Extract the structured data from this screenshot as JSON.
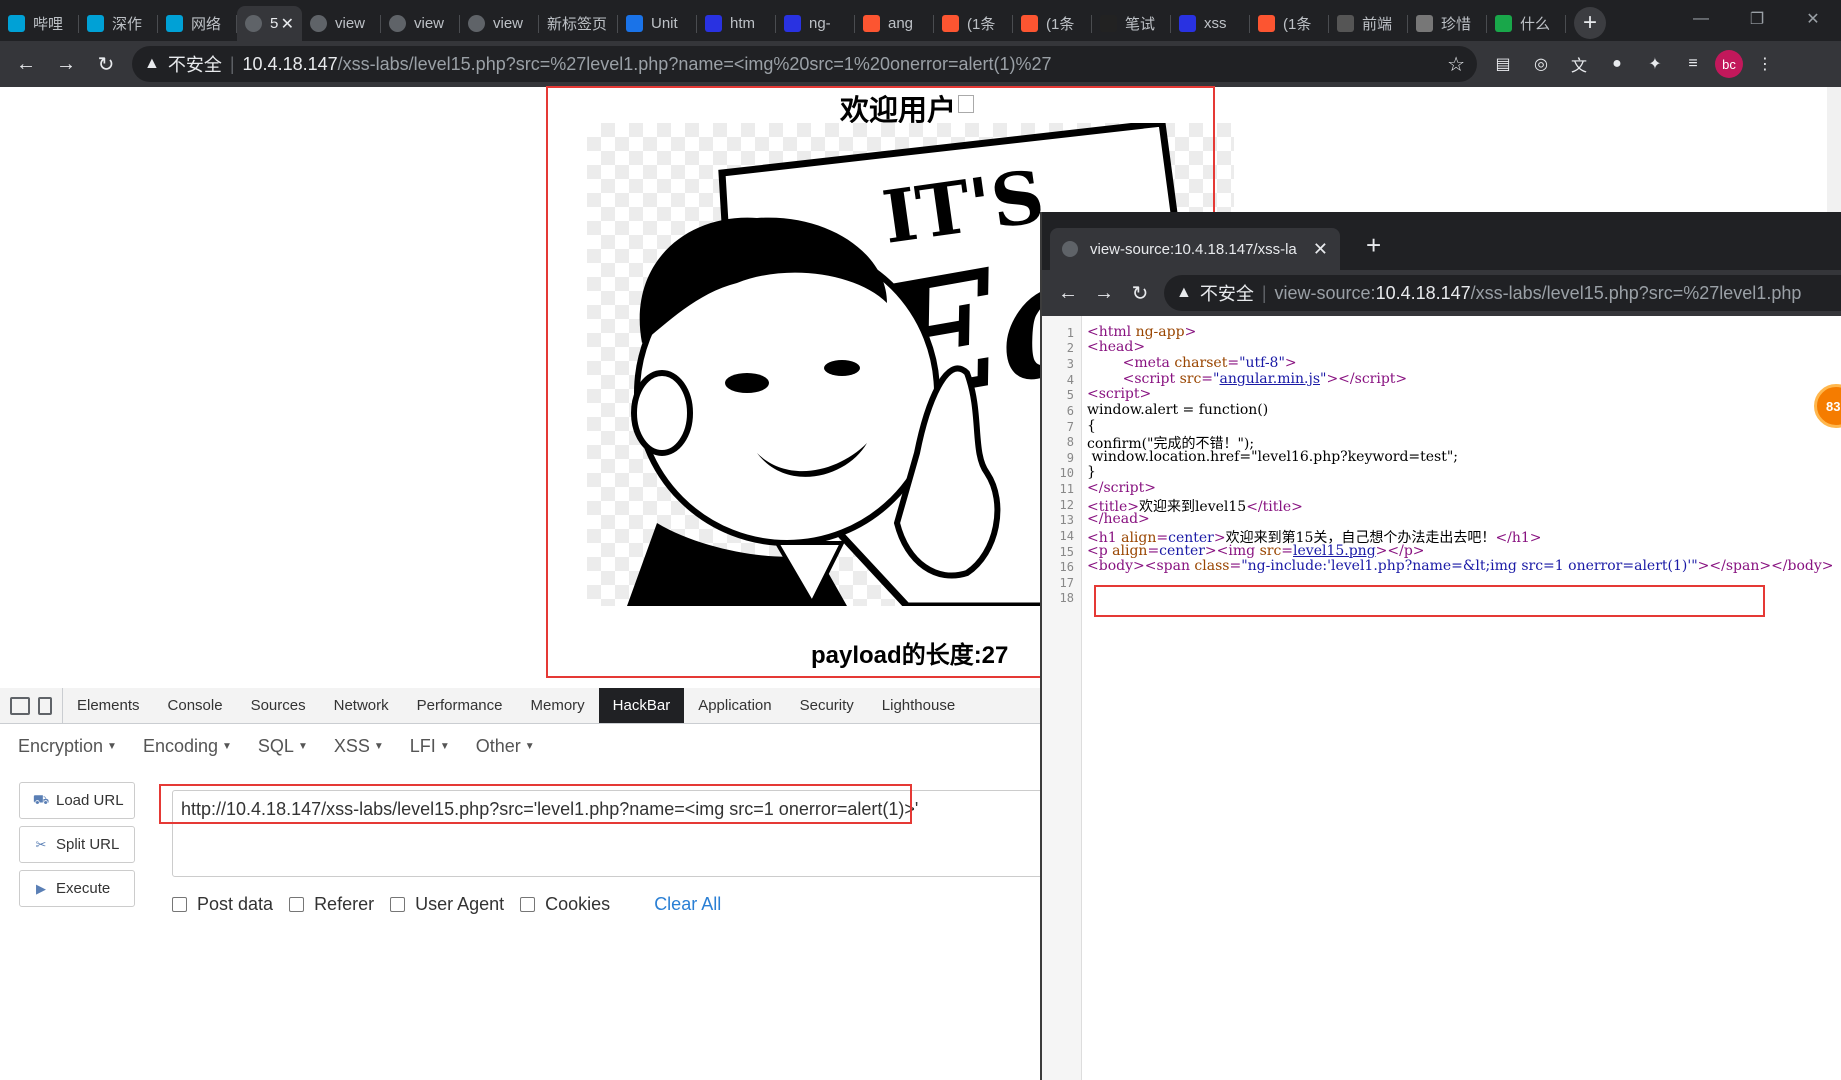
{
  "browser": {
    "tabs": [
      {
        "title": "哔哩",
        "icon": "bilibili-icon",
        "color": "#00a1d6"
      },
      {
        "title": "深作",
        "icon": "bilibili-icon",
        "color": "#00a1d6"
      },
      {
        "title": "网络",
        "icon": "bilibili-icon",
        "color": "#00a1d6"
      },
      {
        "title": "5",
        "icon": "globe-icon",
        "color": "#5f6368",
        "active": true
      },
      {
        "title": "view",
        "icon": "globe-icon",
        "color": "#5f6368"
      },
      {
        "title": "view",
        "icon": "globe-icon",
        "color": "#5f6368"
      },
      {
        "title": "view",
        "icon": "globe-icon",
        "color": "#5f6368"
      },
      {
        "title": "新标签页",
        "icon": "",
        "color": ""
      },
      {
        "title": "Unit",
        "icon": "book-icon",
        "color": "#1a73e8"
      },
      {
        "title": "htm",
        "icon": "baidu-icon",
        "color": "#2932e1"
      },
      {
        "title": "ng-",
        "icon": "baidu-icon",
        "color": "#2932e1"
      },
      {
        "title": "ang",
        "icon": "csdn-icon",
        "color": "#fc5531"
      },
      {
        "title": "(1条",
        "icon": "csdn-icon",
        "color": "#fc5531"
      },
      {
        "title": "(1条",
        "icon": "csdn-icon",
        "color": "#fc5531"
      },
      {
        "title": "笔试",
        "icon": "nowcoder-icon",
        "color": "#222"
      },
      {
        "title": "xss",
        "icon": "baidu-icon",
        "color": "#2932e1"
      },
      {
        "title": "(1条",
        "icon": "csdn-icon",
        "color": "#fc5531"
      },
      {
        "title": "前端",
        "icon": "juejin-icon",
        "color": "#555"
      },
      {
        "title": "珍惜",
        "icon": "w-icon",
        "color": "#777"
      },
      {
        "title": "什么",
        "icon": "green-icon",
        "color": "#19a74a"
      }
    ],
    "new_tab": "+",
    "security_warning": "不安全",
    "url_host": "10.4.18.147",
    "url_path": "/xss-labs/level15.php?src=%27level1.php?name=<img%20src=1%20onerror=alert(1)%27",
    "avatar": "bc"
  },
  "page": {
    "heading": "欢迎用户",
    "payload_length": "payload的长度:27"
  },
  "devtools": {
    "tabs": [
      "Elements",
      "Console",
      "Sources",
      "Network",
      "Performance",
      "Memory",
      "HackBar",
      "Application",
      "Security",
      "Lighthouse"
    ],
    "active_tab": "HackBar"
  },
  "hackbar": {
    "menus": [
      "Encryption",
      "Encoding",
      "SQL",
      "XSS",
      "LFI",
      "Other"
    ],
    "load_url": "Load URL",
    "split_url": "Split URL",
    "execute": "Execute",
    "url_value": "http://10.4.18.147/xss-labs/level15.php?src='level1.php?name=<img src=1 onerror=alert(1)>'",
    "options": [
      "Post data",
      "Referer",
      "User Agent",
      "Cookies"
    ],
    "clear_all": "Clear All"
  },
  "view_source": {
    "tab_title": "view-source:10.4.18.147/xss-la",
    "security_warning": "不安全",
    "url_prefix": "view-source:",
    "url_host": "10.4.18.147",
    "url_path": "/xss-labs/level15.php?src=%27level1.php",
    "line_numbers": [
      "1",
      "2",
      "3",
      "4",
      "5",
      "6",
      "7",
      "8",
      "9",
      "10",
      "11",
      "12",
      "13",
      "14",
      "15",
      "16",
      "17",
      "18"
    ]
  },
  "badge": "83"
}
